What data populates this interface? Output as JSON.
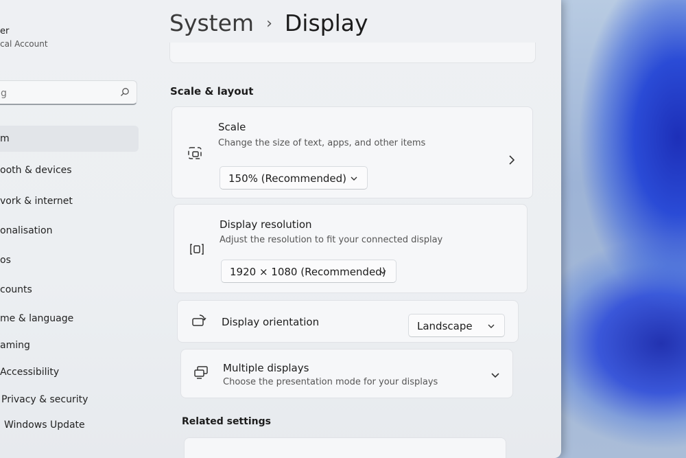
{
  "user": {
    "name": "er",
    "account": "cal Account"
  },
  "search": {
    "placeholder": "g"
  },
  "sidebar": {
    "items": [
      {
        "label": "m"
      },
      {
        "label": "ooth & devices"
      },
      {
        "label": "vork & internet"
      },
      {
        "label": "onalisation"
      },
      {
        "label": "os"
      },
      {
        "label": "counts"
      },
      {
        "label": "me & language"
      },
      {
        "label": "aming"
      },
      {
        "label": "Accessibility"
      },
      {
        "label": "Privacy & security"
      },
      {
        "label": "Windows Update"
      }
    ]
  },
  "header": {
    "parent": "System",
    "separator": "›",
    "title": "Display"
  },
  "section": {
    "title": "Scale & layout"
  },
  "scale": {
    "title": "Scale",
    "description": "Change the size of text, apps, and other items",
    "value": "150% (Recommended)",
    "icon": "scale-icon"
  },
  "resolution": {
    "title": "Display resolution",
    "description": "Adjust the resolution to fit your connected display",
    "value": "1920 × 1080 (Recommended)",
    "icon": "resolution-icon"
  },
  "orientation": {
    "title": "Display orientation",
    "value": "Landscape",
    "icon": "orientation-icon"
  },
  "multiple": {
    "title": "Multiple displays",
    "description": "Choose the presentation mode for your displays",
    "icon": "multiple-displays-icon"
  },
  "related": {
    "title": "Related settings"
  }
}
